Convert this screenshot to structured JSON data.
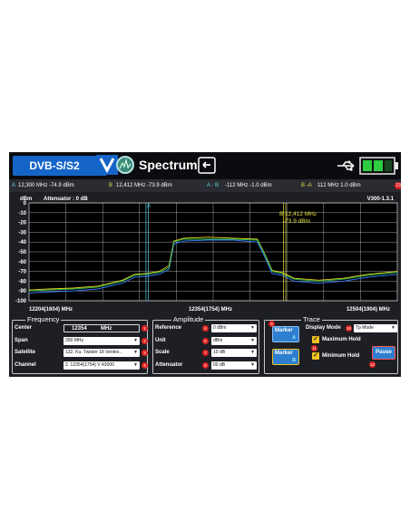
{
  "topbar": {
    "mode_label": "DVB-S/S2",
    "title": "Spectrum",
    "icons": [
      "chevron-down-icon",
      "spectrum-icon",
      "back-icon",
      "usb-icon",
      "battery-icon"
    ],
    "battery_color": "#2ecc40",
    "mode_color": "#1565c8"
  },
  "markers": {
    "a_label": "A",
    "a_value": "12,300 MHz  -74.9 dBm",
    "b_label": "B",
    "b_value": "12,412 MHz  -73.9 dBm",
    "a_b_label": "A - B",
    "a_b_value": "-112 MHz  -1.0 dBm",
    "b_a_label": "B -A",
    "b_a_value": "112 MHz  1.0 dBm",
    "badge": "13",
    "a_color": "#5fd0e0",
    "b_color": "#e8e040"
  },
  "graph": {
    "unit": "dBm",
    "attenuator": "Attenuator : 0 dB",
    "version": "V300-1.3.1",
    "marker_a_tag": "A",
    "marker_b_freq": "B 12,412 MHz",
    "marker_b_level": "-73.9 dBm",
    "x_left": "12204(1604) MHz",
    "x_center": "12354(1754) MHz",
    "x_right": "12504(1904) MHz"
  },
  "chart_data": {
    "type": "line",
    "ylabel": "dBm",
    "ylim": [
      -100,
      0
    ],
    "y_ticks": [
      0,
      -10,
      -20,
      -30,
      -40,
      -50,
      -60,
      -70,
      -80,
      -90,
      -100
    ],
    "x_ticks": [
      "12204(1604) MHz",
      "12354(1754) MHz",
      "12504(1904) MHz"
    ],
    "xlim": [
      12204,
      12504
    ],
    "grid": true,
    "marker_a_x": 12300,
    "marker_b_x": 12412,
    "series": [
      {
        "color": "#3a7cff",
        "x": [
          12204,
          12220,
          12240,
          12260,
          12280,
          12290,
          12300,
          12310,
          12318,
          12322,
          12330,
          12350,
          12370,
          12390,
          12396,
          12402,
          12410,
          12420,
          12440,
          12460,
          12480,
          12504
        ],
        "y": [
          -92,
          -91,
          -90,
          -88,
          -82,
          -76,
          -75,
          -73,
          -68,
          -42,
          -39,
          -38,
          -38,
          -40,
          -55,
          -72,
          -74,
          -80,
          -82,
          -80,
          -76,
          -73
        ]
      },
      {
        "color": "#e8d020",
        "x": [
          12204,
          12220,
          12240,
          12260,
          12280,
          12290,
          12300,
          12310,
          12318,
          12322,
          12330,
          12350,
          12370,
          12390,
          12396,
          12402,
          12410,
          12420,
          12440,
          12460,
          12480,
          12504
        ],
        "y": [
          -89,
          -88,
          -87,
          -85,
          -79,
          -73,
          -72,
          -70,
          -64,
          -39,
          -36,
          -35,
          -36,
          -37,
          -52,
          -69,
          -71,
          -77,
          -79,
          -77,
          -73,
          -70
        ]
      },
      {
        "color": "#30c050",
        "x": [
          12204,
          12220,
          12240,
          12260,
          12280,
          12290,
          12300,
          12310,
          12318,
          12322,
          12330,
          12350,
          12370,
          12390,
          12396,
          12402,
          12410,
          12420,
          12440,
          12460,
          12480,
          12504
        ],
        "y": [
          -90,
          -89,
          -88,
          -86,
          -80,
          -74,
          -73,
          -71,
          -66,
          -40,
          -37,
          -37,
          -37,
          -38,
          -53,
          -70,
          -72,
          -78,
          -80,
          -78,
          -74,
          -71
        ]
      }
    ]
  },
  "frequency": {
    "title": "Frequency",
    "center_label": "Center",
    "center_value": "12354",
    "center_unit": "MHz",
    "span_label": "Span",
    "span_value": "300 MHz",
    "satellite_label": "Satellite",
    "satellite_value": "132. Ku. Twister 18 Ventex..",
    "channel_label": "Channel",
    "channel_value": "2. 12354(1754) V 43000",
    "badges": [
      "1",
      "2",
      "3",
      "4"
    ]
  },
  "amplitude": {
    "title": "Amplitude",
    "reference_label": "Reference",
    "reference_value": "0 dBm",
    "unit_label": "Unit",
    "unit_value": "dBm",
    "scale_label": "Scale",
    "scale_value": "10 dB",
    "attenuator_label": "Attenuator",
    "attenuator_value": "00 dB",
    "badges": [
      "5",
      "6",
      "7",
      "8"
    ]
  },
  "trace": {
    "title": "Trace",
    "marker1_label": "Marker",
    "marker1_sub": "A",
    "marker2_label": "Marker",
    "marker2_sub": "B",
    "display_mode_label": "Display Mode",
    "display_mode_value": "Tp Mode",
    "max_hold_label": "Maximum Hold",
    "min_hold_label": "Minimum Hold",
    "pause_label": "Pause",
    "badges": [
      "9",
      "10",
      "11",
      "12"
    ]
  }
}
